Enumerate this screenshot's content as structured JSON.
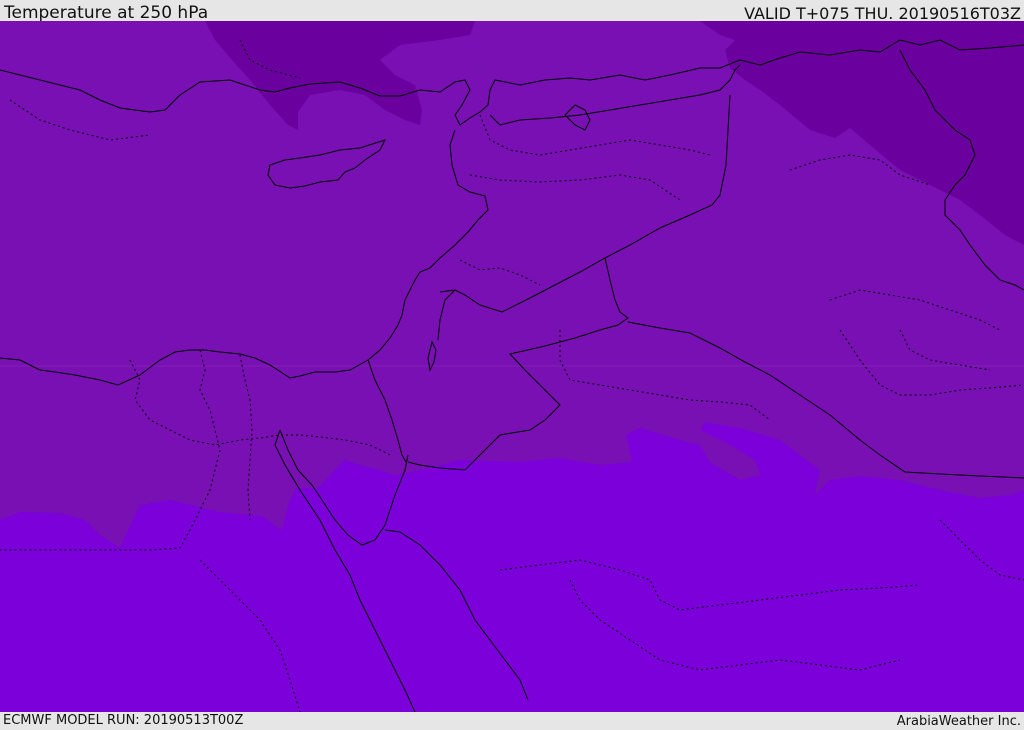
{
  "header": {
    "title": "Temperature at 250 hPa",
    "valid": "VALID T+075 THU. 20190516T03Z"
  },
  "footer": {
    "model_run": "ECMWF MODEL RUN: 20190513T00Z",
    "credit": "ArabiaWeather Inc."
  },
  "map": {
    "field": "temperature",
    "level": "250 hPa",
    "colors": {
      "cold": "#6a009e",
      "mid": "#7810b3",
      "warm": "#7b00d9",
      "border": "#000000"
    }
  }
}
